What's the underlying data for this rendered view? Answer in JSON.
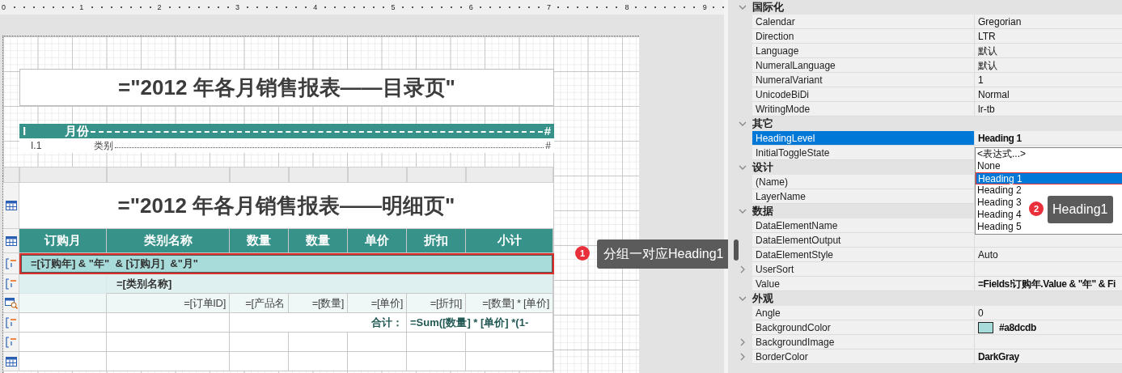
{
  "ruler": [
    "0",
    "1",
    "2",
    "3",
    "4",
    "5",
    "6",
    "7",
    "8",
    "9"
  ],
  "toc": {
    "title": "=\"2012 年各月销售报表——目录页\"",
    "levels": [
      {
        "number": "I",
        "label": "月份",
        "page": "#"
      },
      {
        "number": "I.1",
        "label": "类别",
        "page": "#"
      }
    ]
  },
  "detail": {
    "title": "=\"2012 年各月销售报表——明细页\"",
    "columns": [
      "订购月",
      "类别名称",
      "数量",
      "数量",
      "单价",
      "折扣",
      "小计"
    ],
    "group1": {
      "expression": "=[订购年] & \"年\"  & [订购月]  &\"月\"",
      "selected": true
    },
    "group2": {
      "expression": "=[类别名称]"
    },
    "detail_cells": [
      "=[订单ID]",
      "=[产品名",
      "=[数量]",
      "=[单价]",
      "=[折扣]",
      "=[数量] * [单价]"
    ],
    "total_label": "合计：",
    "total_expression": "=Sum([数量] * [单价] *(1-"
  },
  "annotations": [
    {
      "number": "1",
      "text": "分组一对应Heading1"
    },
    {
      "number": "2",
      "text": "Heading1"
    }
  ],
  "properties": [
    {
      "category": "国际化",
      "expanded": true,
      "items": [
        {
          "name": "Calendar",
          "value": "Gregorian",
          "kind": "plain",
          "modified": false,
          "selected": false
        },
        {
          "name": "Direction",
          "value": "LTR",
          "kind": "plain",
          "modified": false,
          "selected": false
        },
        {
          "name": "Language",
          "value": "默认",
          "kind": "plain",
          "modified": false,
          "selected": false
        },
        {
          "name": "NumeralLanguage",
          "value": "默认",
          "kind": "plain",
          "modified": false,
          "selected": false
        },
        {
          "name": "NumeralVariant",
          "value": "1",
          "kind": "plain",
          "modified": false,
          "selected": false
        },
        {
          "name": "UnicodeBiDi",
          "value": "Normal",
          "kind": "plain",
          "modified": false,
          "selected": false
        },
        {
          "name": "WritingMode",
          "value": "lr-tb",
          "kind": "plain",
          "modified": false,
          "selected": false
        }
      ]
    },
    {
      "category": "其它",
      "expanded": true,
      "items": [
        {
          "name": "HeadingLevel",
          "value": "Heading 1",
          "kind": "plain",
          "modified": true,
          "selected": true
        },
        {
          "name": "InitialToggleState",
          "kind": "plain",
          "modified": false,
          "selected": false
        }
      ]
    },
    {
      "category": "设计",
      "expanded": true,
      "items": [
        {
          "name": "(Name)",
          "kind": "plain",
          "modified": false,
          "selected": false
        },
        {
          "name": "LayerName",
          "kind": "plain",
          "modified": false,
          "selected": false
        }
      ]
    },
    {
      "category": "数据",
      "expanded": true,
      "items": [
        {
          "name": "DataElementName",
          "kind": "plain",
          "modified": false,
          "selected": false
        },
        {
          "name": "DataElementOutput",
          "kind": "plain",
          "modified": false,
          "selected": false
        },
        {
          "name": "DataElementStyle",
          "value": "Auto",
          "kind": "plain",
          "modified": false,
          "selected": false
        },
        {
          "name": "UserSort",
          "kind": "expandable",
          "modified": false,
          "selected": false
        },
        {
          "name": "Value",
          "value": "=Fields!订购年.Value & \"年\"  & Fi",
          "kind": "plain",
          "modified": true,
          "selected": false
        }
      ]
    },
    {
      "category": "外观",
      "expanded": true,
      "items": [
        {
          "name": "Angle",
          "value": "0",
          "kind": "plain",
          "modified": false,
          "selected": false
        },
        {
          "name": "BackgroundColor",
          "value": "#a8dcdb",
          "kind": "color",
          "color": "#a8dcdb",
          "modified": true,
          "selected": false
        },
        {
          "name": "BackgroundImage",
          "kind": "expandable",
          "modified": false,
          "selected": false
        },
        {
          "name": "BorderColor",
          "value": "DarkGray",
          "kind": "expandable",
          "modified": true,
          "selected": false
        }
      ]
    }
  ],
  "dropdown": {
    "options": [
      {
        "label": "<表达式...>",
        "selected": false
      },
      {
        "label": "None",
        "selected": false
      },
      {
        "label": "Heading 1",
        "selected": true
      },
      {
        "label": "Heading 2",
        "selected": false
      },
      {
        "label": "Heading 3",
        "selected": false
      },
      {
        "label": "Heading 4",
        "selected": false
      },
      {
        "label": "Heading 5",
        "selected": false
      }
    ]
  }
}
